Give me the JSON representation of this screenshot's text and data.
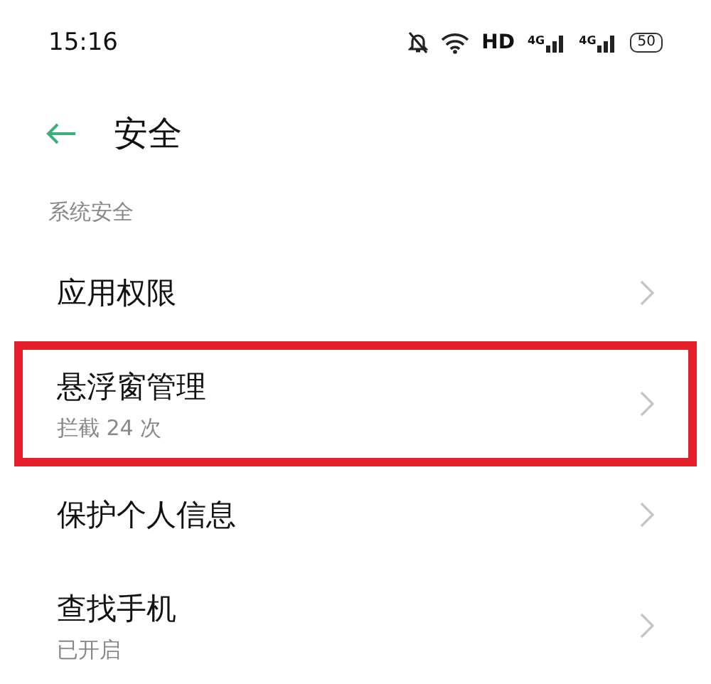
{
  "status_bar": {
    "time": "15:16",
    "hd_label": "HD",
    "signals": [
      {
        "label": "4G"
      },
      {
        "label": "4G"
      }
    ],
    "battery": "50"
  },
  "header": {
    "title": "安全"
  },
  "section": {
    "title": "系统安全"
  },
  "items": [
    {
      "label": "应用权限",
      "highlighted": false
    },
    {
      "label": "悬浮窗管理",
      "subtitle": "拦截 24 次",
      "highlighted": true
    },
    {
      "label": "保护个人信息",
      "highlighted": false
    },
    {
      "label": "查找手机",
      "subtitle": "已开启",
      "highlighted": false
    }
  ]
}
